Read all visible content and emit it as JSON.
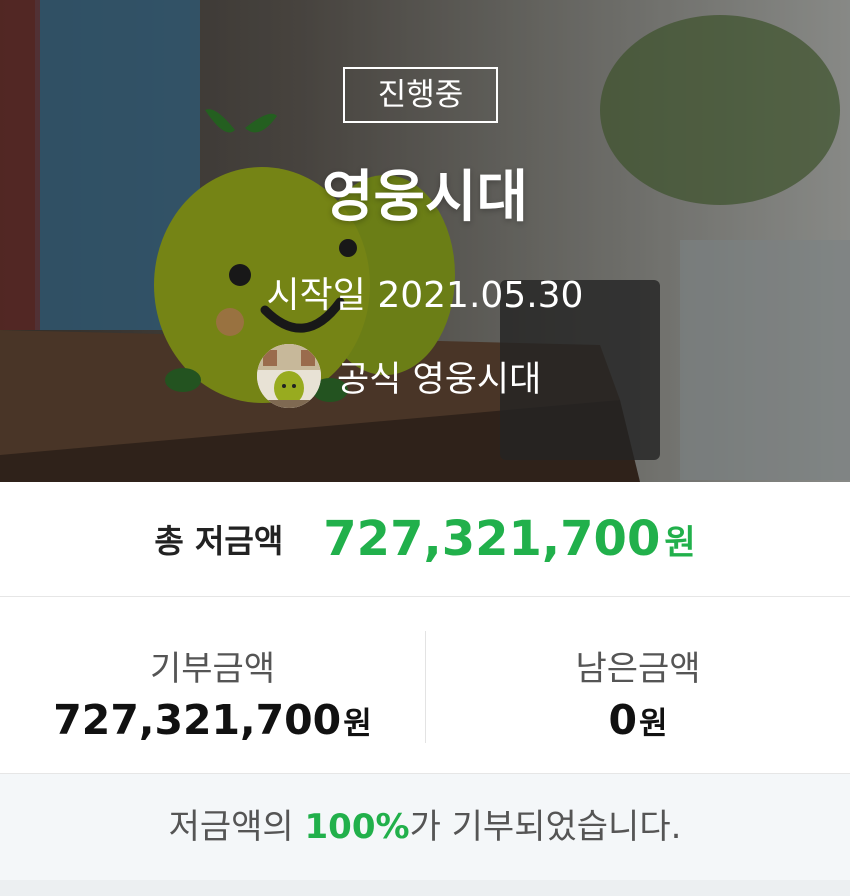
{
  "campaign": {
    "status": "진행중",
    "title": "영웅시대",
    "start_date": "시작일 2021.05.30",
    "organizer": "공식 영웅시대"
  },
  "summary": {
    "total_label": "총 저금액",
    "total_value": "727,321,700",
    "total_unit": "원",
    "donated_label": "기부금액",
    "donated_value": "727,321,700",
    "donated_unit": "원",
    "remaining_label": "남은금액",
    "remaining_value": "0",
    "remaining_unit": "원"
  },
  "footer": {
    "prefix": "저금액의 ",
    "percent": "100%",
    "suffix": "가 기부되었습니다."
  },
  "icons": {
    "avatar": "organizer-avatar"
  },
  "colors": {
    "accent": "#21b04b"
  }
}
